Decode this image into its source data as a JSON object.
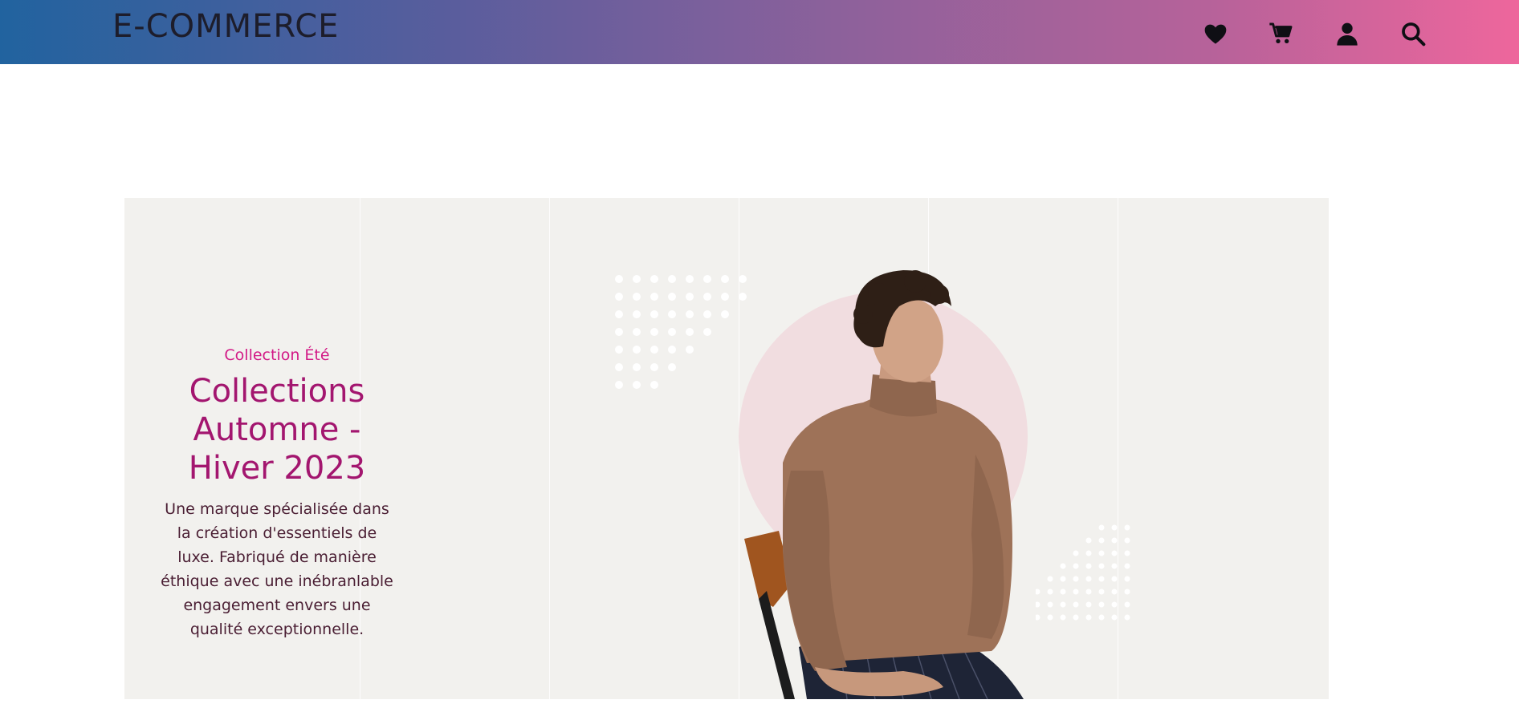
{
  "header": {
    "logo": "E-COMMERCE",
    "icons": [
      "heart-icon",
      "cart-icon",
      "user-icon",
      "search-icon"
    ],
    "colors": {
      "gradient_start": "#21639f",
      "gradient_end": "#ee669c"
    }
  },
  "hero": {
    "subtitle": "Collection Été",
    "title_lines": [
      "Collections",
      "Automne -",
      "Hiver 2023"
    ],
    "description_lines": [
      "Une marque spécialisée dans",
      "la création d'essentiels de",
      "luxe. Fabriqué de manière",
      "éthique avec une inébranlable",
      "engagement envers une",
      "qualité exceptionnelle."
    ],
    "colors": {
      "subtitle": "#d21a86",
      "title": "#a3166f",
      "background": "#f2f1ee",
      "circle": "#f1dde0"
    }
  }
}
